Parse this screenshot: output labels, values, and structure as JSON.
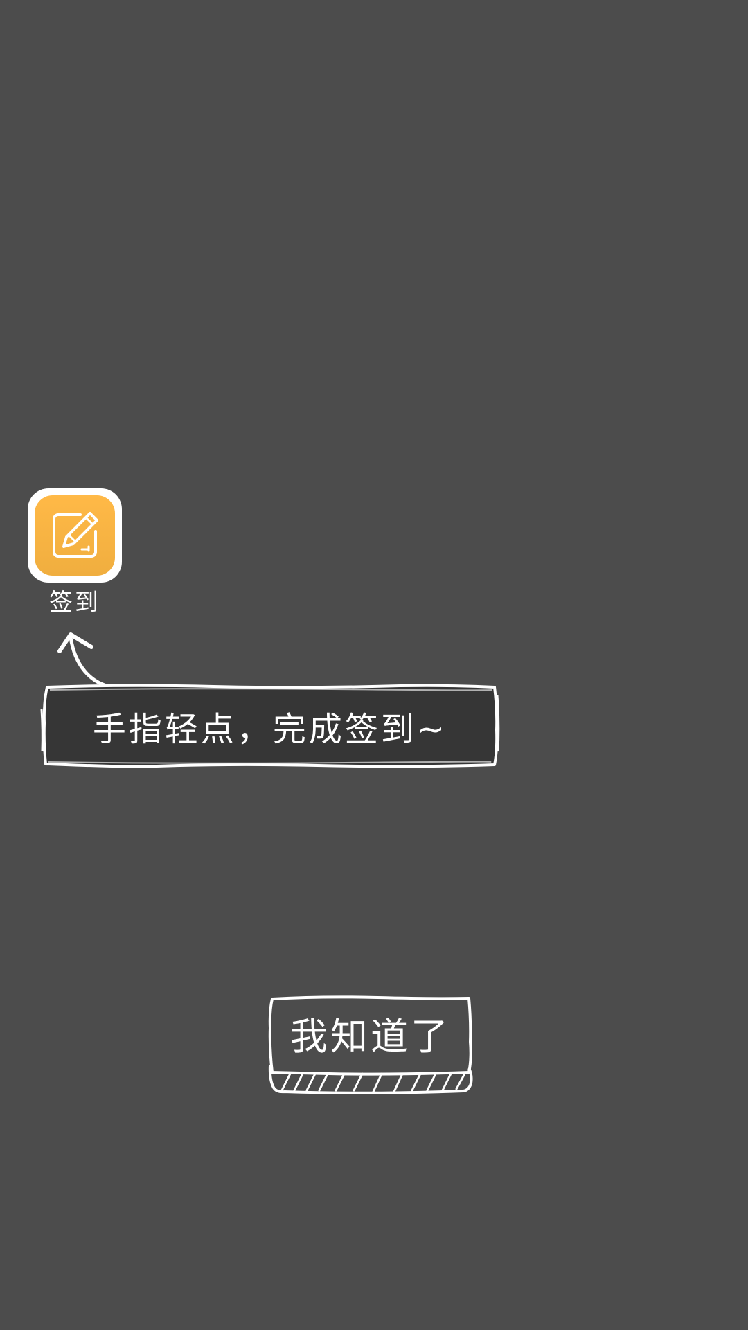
{
  "checkin": {
    "label": "签到",
    "icon": "edit-pencil-icon",
    "accent_color": "#f5b042"
  },
  "tip": {
    "text": "手指轻点，完成签到~"
  },
  "dismiss": {
    "label": "我知道了"
  },
  "colors": {
    "overlay": "#4c4c4c",
    "tip_background": "#363636",
    "sketch_line": "#ffffff"
  }
}
